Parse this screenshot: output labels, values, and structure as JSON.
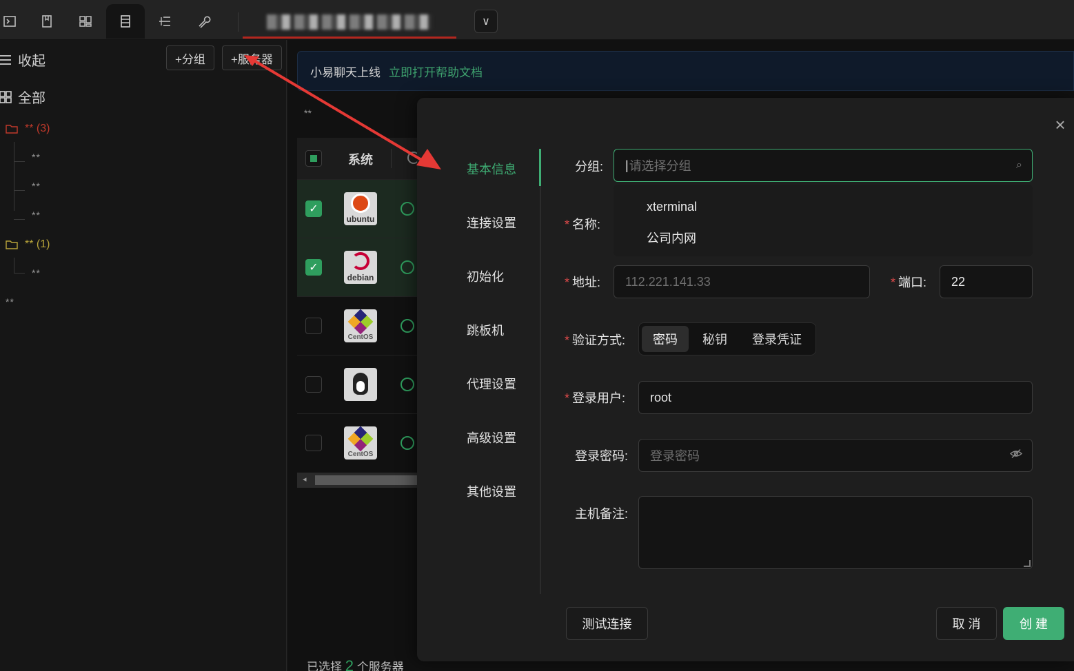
{
  "topbar": {
    "icons": [
      "terminal-icon",
      "bookmark-icon",
      "dashboard-icon",
      "server-list-icon",
      "tree-icon",
      "wrench-icon"
    ],
    "dropdown_glyph": "∨"
  },
  "sidebar": {
    "collapse_label": "收起",
    "add_group_label": "+分组",
    "add_server_label": "+服务器",
    "all_label": "全部",
    "groups": [
      {
        "label": "** (3)",
        "color": "#c0392b",
        "children": [
          "**",
          "**",
          "**"
        ]
      },
      {
        "label": "** (1)",
        "color": "#b8a43a",
        "children": [
          "**"
        ]
      }
    ],
    "ungrouped": "**"
  },
  "main": {
    "banner_text": "小易聊天上线",
    "banner_link": "立即打开帮助文档",
    "stars": "**",
    "table": {
      "header_system": "系统",
      "rows": [
        {
          "os": "ubuntu",
          "checked": true
        },
        {
          "os": "debian",
          "checked": true
        },
        {
          "os": "CentOS",
          "checked": false
        },
        {
          "os": "",
          "checked": false
        },
        {
          "os": "CentOS",
          "checked": false
        }
      ]
    },
    "footer_prefix": "已选择",
    "footer_count": "2",
    "footer_suffix": "个服务器"
  },
  "modal": {
    "nav": [
      "基本信息",
      "连接设置",
      "初始化",
      "跳板机",
      "代理设置",
      "高级设置",
      "其他设置"
    ],
    "fields": {
      "group_label": "分组:",
      "group_placeholder": "请选择分组",
      "group_options": [
        "xterminal",
        "公司内网"
      ],
      "name_label": "名称:",
      "address_label": "地址:",
      "address_placeholder": "112.221.141.33",
      "port_label": "端口:",
      "port_value": "22",
      "auth_label": "验证方式:",
      "auth_options": [
        "密码",
        "秘钥",
        "登录凭证"
      ],
      "user_label": "登录用户:",
      "user_value": "root",
      "password_label": "登录密码:",
      "password_placeholder": "登录密码",
      "note_label": "主机备注:"
    },
    "buttons": {
      "test": "测试连接",
      "cancel": "取 消",
      "create": "创 建"
    }
  },
  "colors": {
    "accent": "#3fae74",
    "required": "#e24b4b",
    "arrow": "#e53935"
  }
}
